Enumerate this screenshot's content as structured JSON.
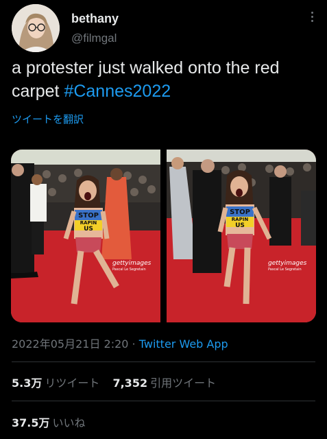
{
  "author": {
    "display_name": "bethany",
    "handle": "@filmgal"
  },
  "tweet": {
    "text": "a protester just walked onto the red carpet ",
    "hashtag": "#Cannes2022",
    "translate_label": "ツイートを翻訳"
  },
  "media": [
    {
      "sign_text_1": "STOP",
      "sign_text_2": "RAPIN",
      "sign_text_3": "US",
      "watermark": "gettyimages",
      "credit": "Pascal Le Segretain"
    },
    {
      "sign_text_1": "STOP",
      "sign_text_2": "RAPIN",
      "sign_text_3": "US",
      "watermark": "gettyimages",
      "credit": "Pascal Le Segretain"
    }
  ],
  "meta": {
    "timestamp": "2022年05月21日 2:20",
    "separator": " · ",
    "source": "Twitter Web App"
  },
  "stats": {
    "retweets_count": "5.3万",
    "retweets_label": "リツイート",
    "quotes_count": "7,352",
    "quotes_label": "引用ツイート",
    "likes_count": "37.5万",
    "likes_label": "いいね"
  },
  "colors": {
    "background": "#000000",
    "accent": "#1d9bf0",
    "text_primary": "#e7e9ea",
    "text_secondary": "#71767b",
    "divider": "#2f3336",
    "carpet_red": "#c8232a"
  }
}
